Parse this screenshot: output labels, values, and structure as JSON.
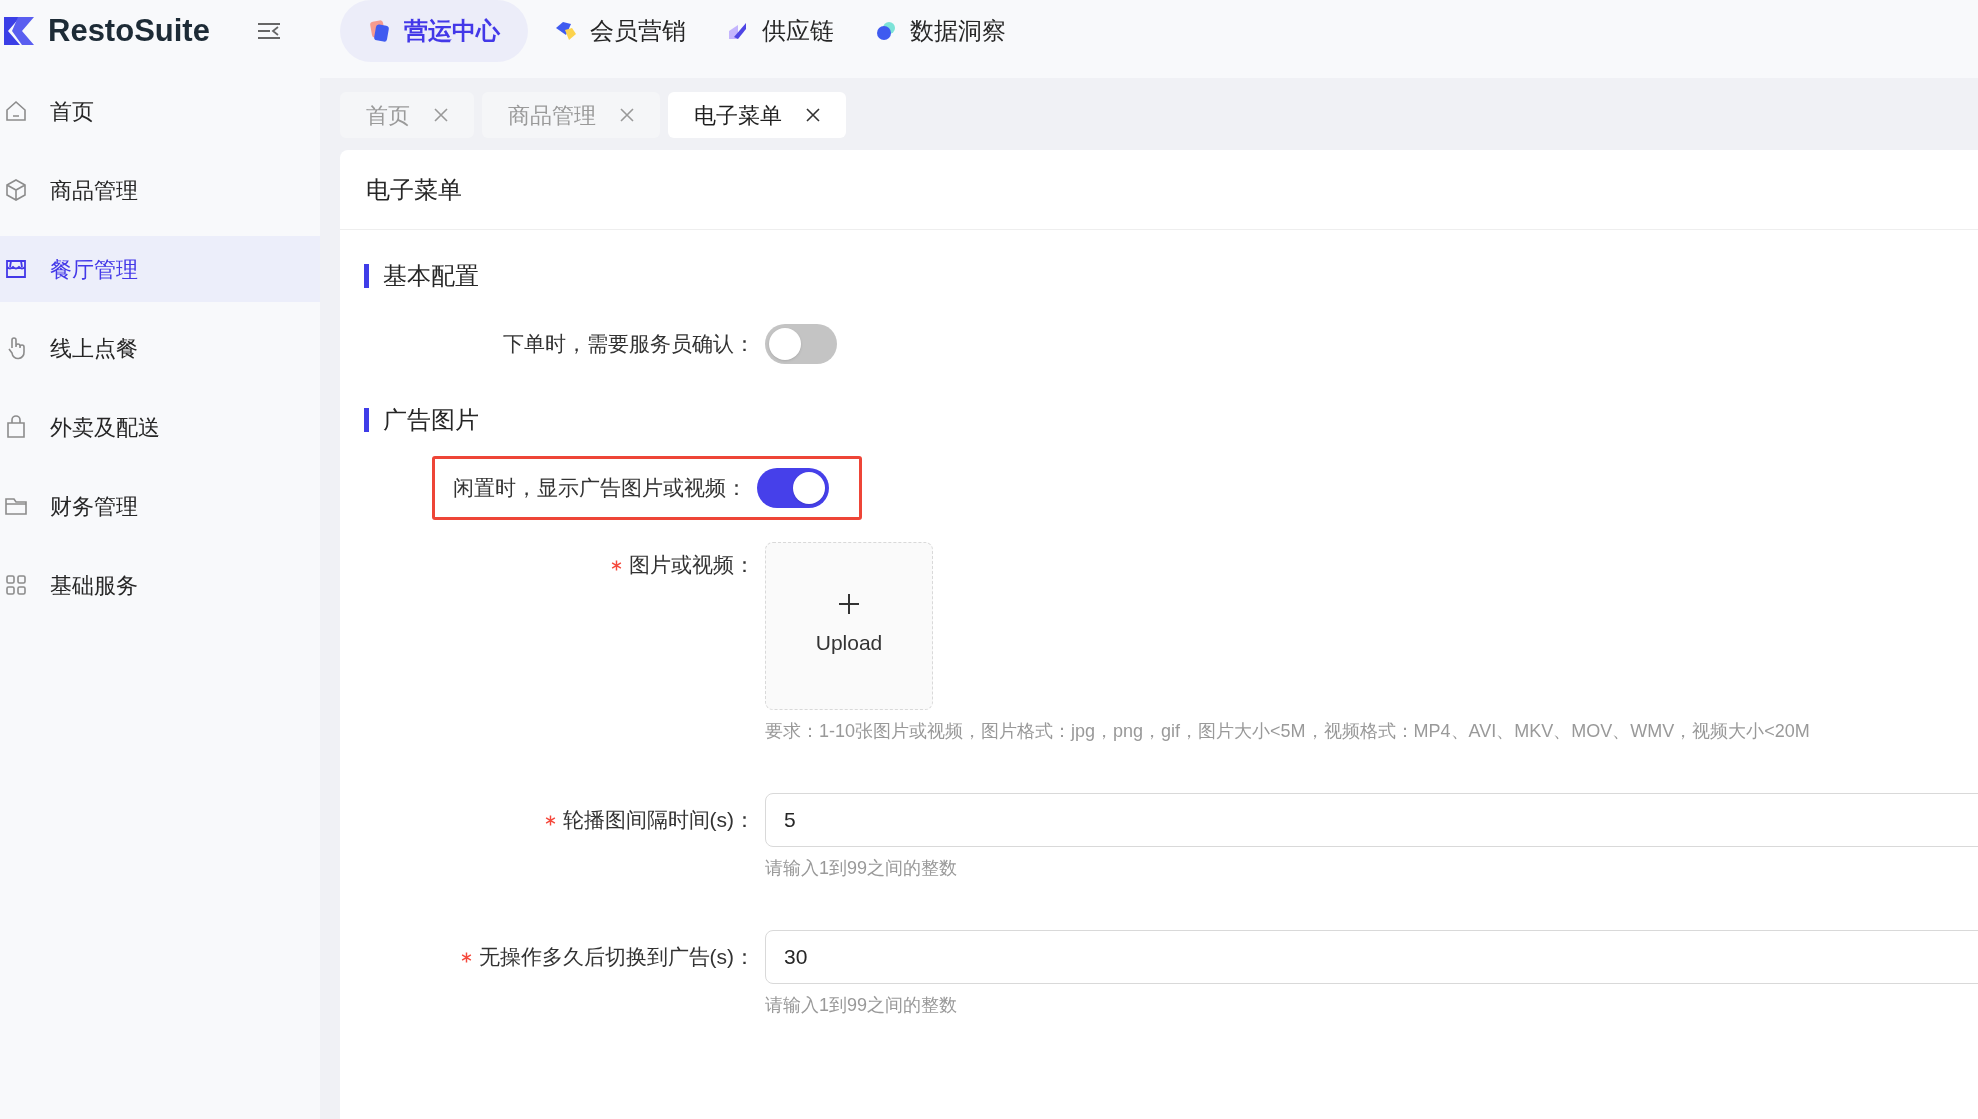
{
  "logo": {
    "text": "RestoSuite"
  },
  "top_nav": [
    {
      "label": "营运中心",
      "selected": true,
      "kind": "ops"
    },
    {
      "label": "会员营销",
      "selected": false,
      "kind": "member"
    },
    {
      "label": "供应链",
      "selected": false,
      "kind": "supply"
    },
    {
      "label": "数据洞察",
      "selected": false,
      "kind": "data"
    }
  ],
  "sidebar": {
    "items": [
      {
        "label": "首页",
        "kind": "home",
        "selected": false
      },
      {
        "label": "商品管理",
        "kind": "product",
        "selected": false
      },
      {
        "label": "餐厅管理",
        "kind": "store",
        "selected": true
      },
      {
        "label": "线上点餐",
        "kind": "hand",
        "selected": false
      },
      {
        "label": "外卖及配送",
        "kind": "bag",
        "selected": false
      },
      {
        "label": "财务管理",
        "kind": "folder",
        "selected": false
      },
      {
        "label": "基础服务",
        "kind": "grid",
        "selected": false
      }
    ]
  },
  "tabs": [
    {
      "label": "首页",
      "selected": false
    },
    {
      "label": "商品管理",
      "selected": false
    },
    {
      "label": "电子菜单",
      "selected": true
    }
  ],
  "page": {
    "title": "电子菜单",
    "sections": [
      {
        "title": "基本配置",
        "fields": [
          {
            "kind": "switch",
            "label": "下单时，需要服务员确认：",
            "on": false,
            "required": false,
            "highlighted": false
          }
        ]
      },
      {
        "title": "广告图片",
        "fields": [
          {
            "kind": "switch",
            "label": "闲置时，显示广告图片或视频：",
            "on": true,
            "required": false,
            "highlighted": true
          },
          {
            "kind": "upload",
            "label": "图片或视频：",
            "required": true,
            "highlighted": false,
            "button": "Upload",
            "hint": "要求：1-10张图片或视频，图片格式：jpg，png，gif，图片大小<5M，视频格式：MP4、AVI、MKV、MOV、WMV，视频大小<20M"
          },
          {
            "kind": "input",
            "label": "轮播图间隔时间(s)：",
            "required": true,
            "highlighted": false,
            "value": "5",
            "hint": "请输入1到99之间的整数"
          },
          {
            "kind": "input",
            "label": "无操作多久后切换到广告(s)：",
            "required": true,
            "highlighted": false,
            "value": "30",
            "hint": "请输入1到99之间的整数"
          }
        ]
      }
    ]
  }
}
